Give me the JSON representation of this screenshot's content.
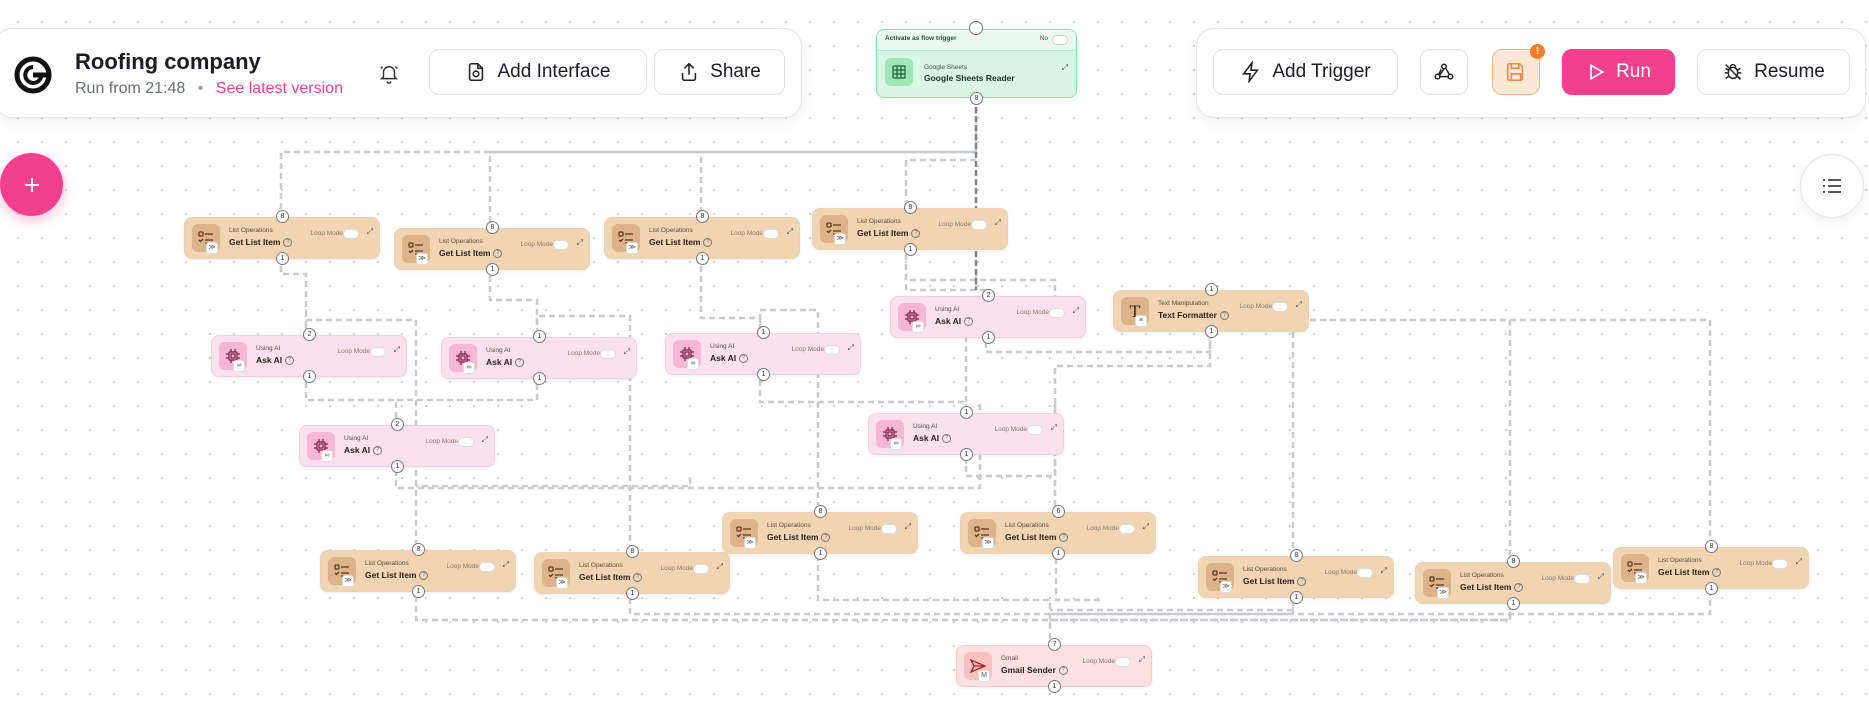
{
  "project": {
    "title": "Roofing company",
    "run_info": "Run from 21:48",
    "separator": "•",
    "latest_link": "See latest version"
  },
  "toolbar": {
    "add_interface": "Add Interface",
    "share": "Share",
    "add_trigger": "Add Trigger",
    "run": "Run",
    "resume": "Resume",
    "save_badge": "!"
  },
  "colors": {
    "accent": "#f2408f",
    "list_node": "#f1d5b3",
    "ai_node": "#fbe1ee",
    "trigger_node": "#d8f6e2",
    "gmail_node": "#fde0e0"
  },
  "trigger": {
    "activate_label": "Activate as flow trigger",
    "activate_value": "No",
    "category": "Google Sheets",
    "name": "Google Sheets Reader",
    "out_port": "8"
  },
  "labels": {
    "loop_mode": "Loop Mode",
    "help": "?"
  },
  "nodes": [
    {
      "kind": "list",
      "category": "List Operations",
      "name": "Get List Item",
      "in": "8",
      "out": "1"
    },
    {
      "kind": "list",
      "category": "List Operations",
      "name": "Get List Item",
      "in": "8",
      "out": "1"
    },
    {
      "kind": "list",
      "category": "List Operations",
      "name": "Get List Item",
      "in": "8",
      "out": "1"
    },
    {
      "kind": "list",
      "category": "List Operations",
      "name": "Get List Item",
      "in": "8",
      "out": "1"
    },
    {
      "kind": "ai",
      "category": "Using AI",
      "name": "Ask AI",
      "in": "2",
      "out": "1"
    },
    {
      "kind": "ai",
      "category": "Using AI",
      "name": "Ask AI",
      "in": "1",
      "out": "1"
    },
    {
      "kind": "ai",
      "category": "Using AI",
      "name": "Ask AI",
      "in": "1",
      "out": "1"
    },
    {
      "kind": "ai",
      "category": "Using AI",
      "name": "Ask AI",
      "in": "2",
      "out": "1"
    },
    {
      "kind": "text",
      "category": "Text Manipulation",
      "name": "Text Formatter",
      "in": "1",
      "out": "1"
    },
    {
      "kind": "ai",
      "category": "Using AI",
      "name": "Ask AI",
      "in": "2",
      "out": "1"
    },
    {
      "kind": "ai",
      "category": "Using AI",
      "name": "Ask AI",
      "in": "1",
      "out": "1"
    },
    {
      "kind": "list",
      "category": "List Operations",
      "name": "Get List Item",
      "in": "8",
      "out": "1"
    },
    {
      "kind": "list",
      "category": "List Operations",
      "name": "Get List Item",
      "in": "8",
      "out": "1"
    },
    {
      "kind": "list",
      "category": "List Operations",
      "name": "Get List Item",
      "in": "8",
      "out": "1"
    },
    {
      "kind": "list",
      "category": "List Operations",
      "name": "Get List Item",
      "in": "6",
      "out": "1"
    },
    {
      "kind": "list",
      "category": "List Operations",
      "name": "Get List Item",
      "in": "8",
      "out": "1"
    },
    {
      "kind": "list",
      "category": "List Operations",
      "name": "Get List Item",
      "in": "8",
      "out": "1"
    },
    {
      "kind": "list",
      "category": "List Operations",
      "name": "Get List Item",
      "in": "8",
      "out": "1"
    },
    {
      "kind": "gmail",
      "category": "Gmail",
      "name": "Gmail Sender",
      "in": "7",
      "out": "1"
    }
  ]
}
